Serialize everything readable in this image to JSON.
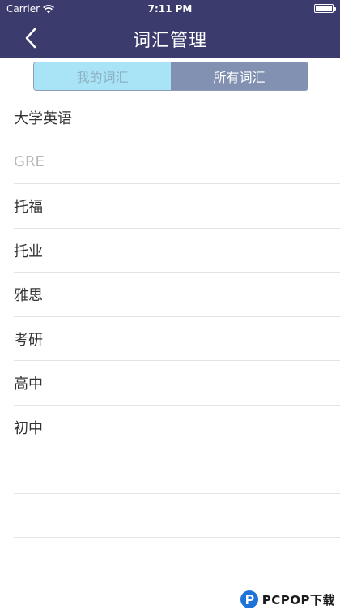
{
  "status_bar": {
    "carrier": "Carrier",
    "time": "7:11 PM"
  },
  "nav": {
    "title": "词汇管理",
    "back_icon": "chevron-left-icon"
  },
  "segments": [
    {
      "label": "我的词汇",
      "selected": false
    },
    {
      "label": "所有词汇",
      "selected": true
    }
  ],
  "vocab_list": [
    {
      "label": "大学英语",
      "enabled": true
    },
    {
      "label": "GRE",
      "enabled": false
    },
    {
      "label": "托福",
      "enabled": true
    },
    {
      "label": "托业",
      "enabled": true
    },
    {
      "label": "雅思",
      "enabled": true
    },
    {
      "label": "考研",
      "enabled": true
    },
    {
      "label": "高中",
      "enabled": true
    },
    {
      "label": "初中",
      "enabled": true
    }
  ],
  "watermark": {
    "text": "PCPOP下载"
  },
  "colors": {
    "nav_background": "#3b3b6d",
    "segment_unselected": "#a9e4f6",
    "segment_selected": "#8290b2",
    "text": "#333333",
    "disabled_text": "#b8b8b8"
  }
}
